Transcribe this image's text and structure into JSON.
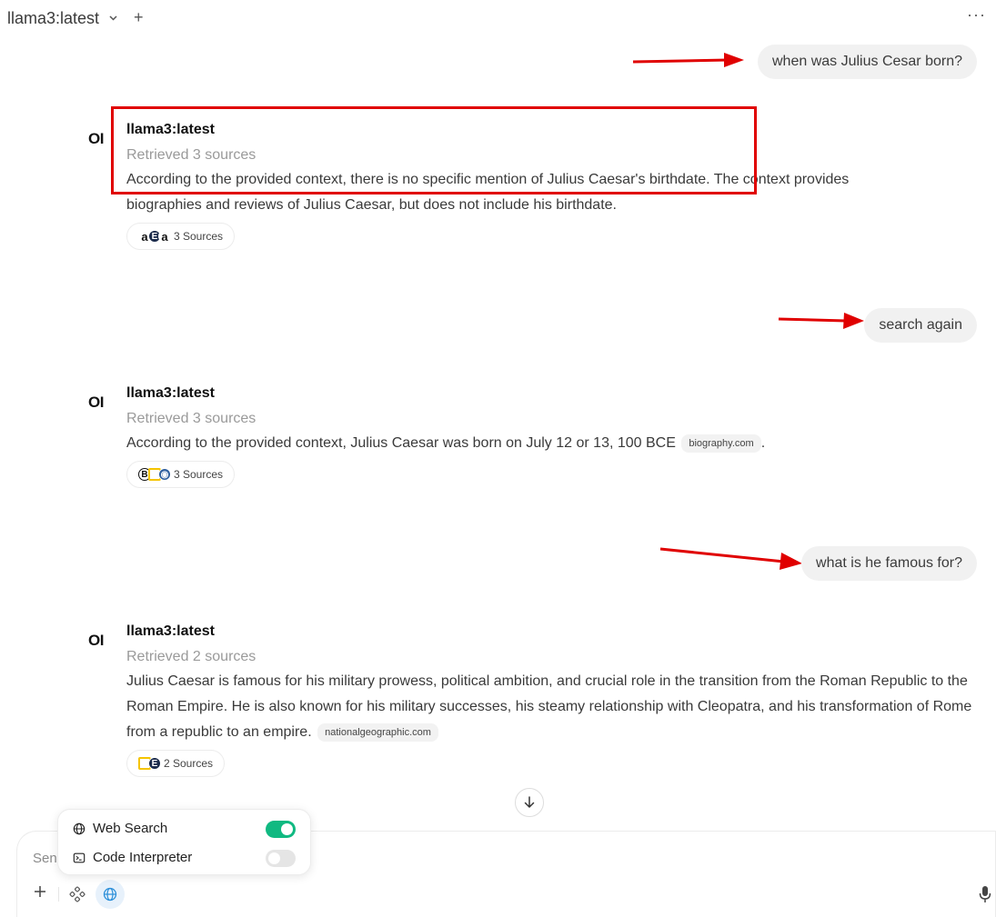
{
  "header": {
    "model_name": "llama3:latest",
    "new_chat_label": "+",
    "more_label": "···"
  },
  "conversation": [
    {
      "user": "when was Julius Cesar born?",
      "assistant_name": "llama3:latest",
      "retrieved": "Retrieved 3 sources",
      "answer_part1": "According to the provided context, there is no specific mention of Julius Caesar's birthdate.",
      "answer_part2": " The context provides biographies and reviews of Julius Caesar, but does not include his birthdate.",
      "sources_label": "3 Sources"
    },
    {
      "user": "search again",
      "assistant_name": "llama3:latest",
      "retrieved": "Retrieved 3 sources",
      "answer": "According to the provided context, Julius Caesar was born on July 12 or 13, 100 BCE",
      "citation": "biography.com",
      "tail": ".",
      "sources_label": "3 Sources"
    },
    {
      "user": "what is he famous for?",
      "assistant_name": "llama3:latest",
      "retrieved": "Retrieved 2 sources",
      "answer": "Julius Caesar is famous for his military prowess, political ambition, and crucial role in the transition from the Roman Republic to the Roman Empire. He is also known for his military successes, his steamy relationship with Cleopatra, and his transformation of Rome from a republic to an empire.",
      "citation": "nationalgeographic.com",
      "sources_label": "2 Sources"
    }
  ],
  "logo_text": "OI",
  "composer": {
    "placeholder": "Sen"
  },
  "tools_menu": {
    "web_search_label": "Web Search",
    "web_search_on": true,
    "code_interpreter_label": "Code Interpreter",
    "code_interpreter_on": false
  },
  "colors": {
    "annotation_red": "#e00000",
    "toggle_on": "#10b981",
    "toggle_off": "#e5e5e5",
    "globe_active": "#2b8fd9"
  },
  "icons": [
    "chevron-down-icon",
    "plus-icon",
    "more-icon",
    "arrow-down-icon",
    "globe-icon",
    "terminal-icon",
    "tools-icon",
    "mic-icon"
  ]
}
